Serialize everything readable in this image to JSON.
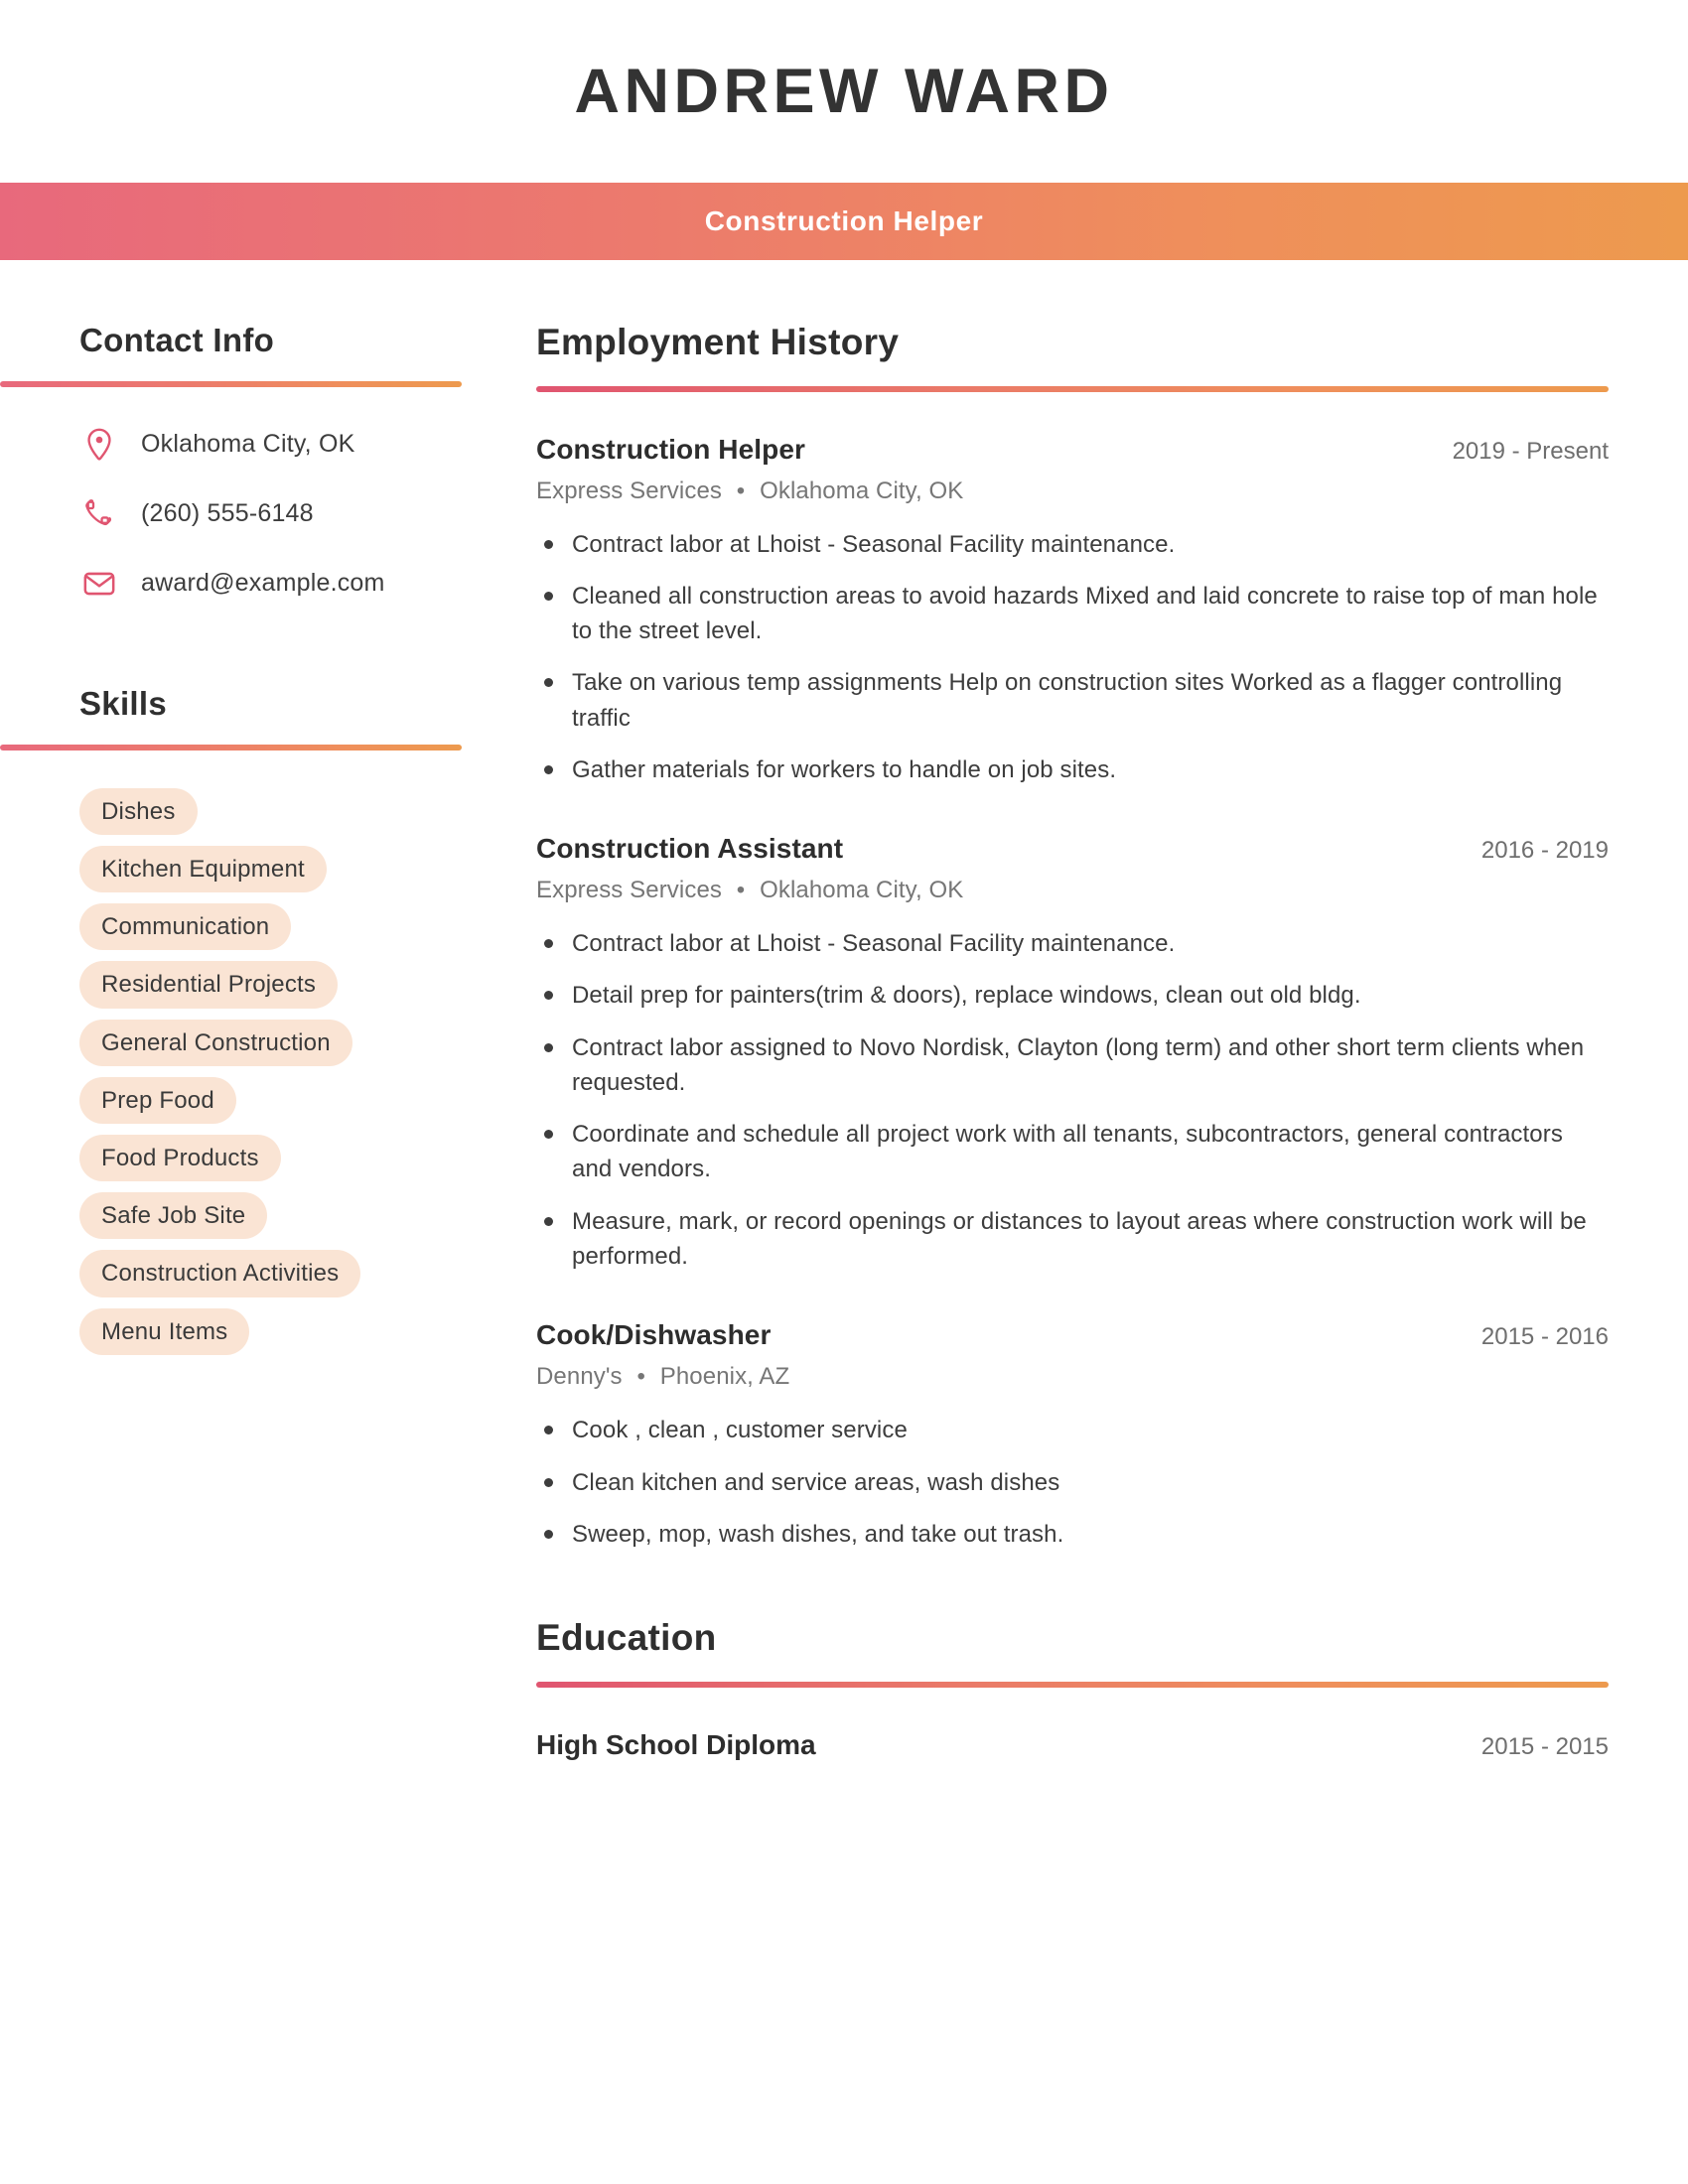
{
  "header": {
    "name": "ANDREW WARD",
    "job_title": "Construction Helper"
  },
  "colors": {
    "gradient_start": "#e8697c",
    "gradient_end": "#ed9a4e",
    "icon": "#e05570",
    "pill_bg": "#fae4d4",
    "heading": "#2f2f2f",
    "body_text": "#3d3d3d",
    "muted_text": "#767676"
  },
  "sidebar": {
    "contact": {
      "heading": "Contact Info",
      "items": [
        {
          "icon": "location-pin-icon",
          "value": "Oklahoma City, OK"
        },
        {
          "icon": "phone-icon",
          "value": "(260) 555-6148"
        },
        {
          "icon": "envelope-icon",
          "value": "award@example.com"
        }
      ]
    },
    "skills": {
      "heading": "Skills",
      "items": [
        "Dishes",
        "Kitchen Equipment",
        "Communication",
        "Residential Projects",
        "General Construction",
        "Prep Food",
        "Food Products",
        "Safe Job Site",
        "Construction Activities",
        "Menu Items"
      ]
    }
  },
  "main": {
    "employment": {
      "heading": "Employment History",
      "jobs": [
        {
          "role": "Construction Helper",
          "dates": "2019 - Present",
          "company": "Express Services",
          "location": "Oklahoma City, OK",
          "bullets": [
            "Contract labor at Lhoist - Seasonal Facility maintenance.",
            "Cleaned all construction areas to avoid hazards Mixed and laid concrete to raise top of man hole to the street level.",
            "Take on various temp assignments Help on construction sites Worked as a flagger controlling traffic",
            "Gather materials for workers to handle on job sites."
          ]
        },
        {
          "role": "Construction Assistant",
          "dates": "2016 - 2019",
          "company": "Express Services",
          "location": "Oklahoma City, OK",
          "bullets": [
            "Contract labor at Lhoist - Seasonal Facility maintenance.",
            "Detail prep for painters(trim & doors), replace windows, clean out old bldg.",
            "Contract labor assigned to Novo Nordisk, Clayton (long term) and other short term clients when requested.",
            "Coordinate and schedule all project work with all tenants, subcontractors, general contractors and vendors.",
            "Measure, mark, or record openings or distances to layout areas where construction work will be performed."
          ]
        },
        {
          "role": "Cook/Dishwasher",
          "dates": "2015 - 2016",
          "company": "Denny's",
          "location": "Phoenix, AZ",
          "bullets": [
            "Cook , clean , customer service",
            "Clean kitchen and service areas, wash dishes",
            "Sweep, mop, wash dishes, and take out trash."
          ]
        }
      ]
    },
    "education": {
      "heading": "Education",
      "items": [
        {
          "degree": "High School Diploma",
          "dates": "2015 - 2015"
        }
      ]
    }
  }
}
